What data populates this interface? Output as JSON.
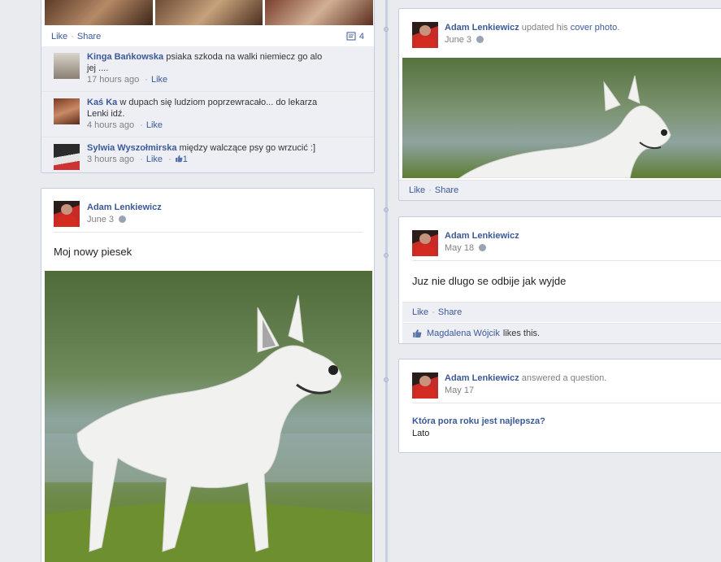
{
  "left_top_post": {
    "actions": {
      "like": "Like",
      "share": "Share",
      "comment_count": "4"
    },
    "comments": [
      {
        "author": "Kinga Bańkowska",
        "text_line1": "psiaka szkoda na walki niemiecz go alo",
        "text_line2": "jej ....",
        "time": "17 hours ago",
        "like": "Like"
      },
      {
        "author": "Kaś Ka",
        "text_line1": "w dupach się ludziom poprzewracało... do lekarza",
        "text_line2": "Lenki idź.",
        "time": "4 hours ago",
        "like": "Like"
      },
      {
        "author": "Sylwia Wyszołmirska",
        "text_line1": "między walczące psy go wrzucić :]",
        "time": "3 hours ago",
        "like": "Like",
        "like_count": "1"
      }
    ]
  },
  "left_post": {
    "author": "Adam Lenkiewicz",
    "date": "June 3",
    "text": "Moj nowy piesek"
  },
  "right_cover_post": {
    "author": "Adam Lenkiewicz",
    "action_prefix": "updated his",
    "action_link": "cover photo",
    "action_suffix": ".",
    "date": "June 3",
    "actions": {
      "like": "Like",
      "share": "Share"
    }
  },
  "right_status_post": {
    "author": "Adam Lenkiewicz",
    "date": "May 18",
    "text": "Juz nie dlugo se odbije jak wyjde",
    "actions": {
      "like": "Like",
      "share": "Share"
    },
    "likes": {
      "name": "Magdalena Wójcik",
      "suffix": "likes this."
    }
  },
  "right_question_post": {
    "author": "Adam Lenkiewicz",
    "action": "answered a question.",
    "date": "May 17",
    "question": "Która pora roku jest najlepsza?",
    "answer": "Lato"
  },
  "icons": [
    "comment-icon",
    "globe-icon",
    "thumbs-up-icon"
  ],
  "colors": {
    "link": "#3b5998",
    "background": "#e9ebee",
    "border": "#c4cde0"
  }
}
